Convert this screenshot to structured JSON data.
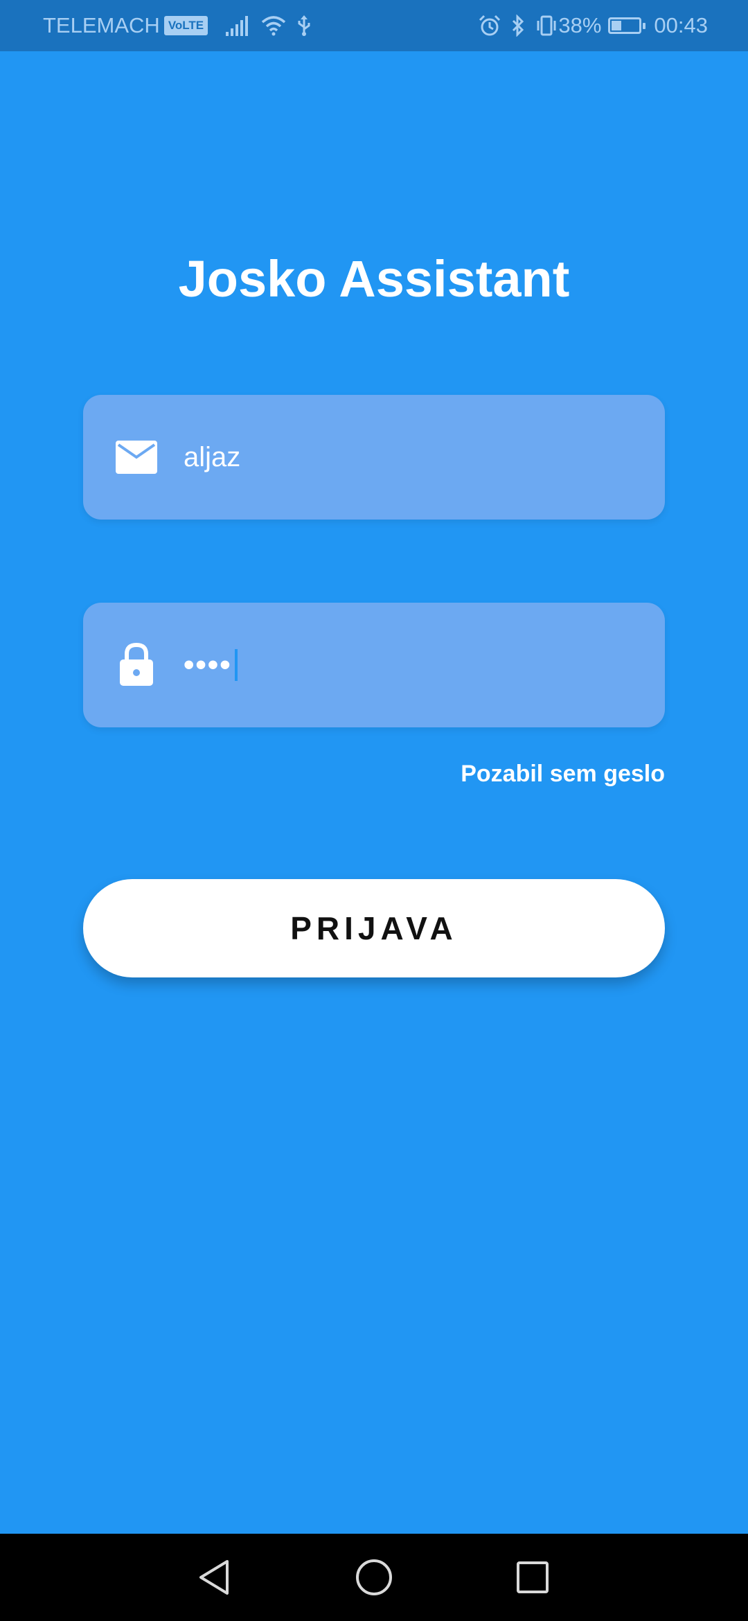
{
  "status_bar": {
    "carrier": "TELEMACH",
    "volte": "VoLTE",
    "battery_percent": "38%",
    "battery_level": 0.38,
    "time": "00:43",
    "icons": [
      "signal-icon",
      "wifi-icon",
      "usb-icon",
      "alarm-icon",
      "bluetooth-icon",
      "vibrate-icon",
      "battery-charging-icon"
    ]
  },
  "app": {
    "title": "Josko Assistant"
  },
  "login_form": {
    "email": {
      "icon": "mail-icon",
      "value": "aljaz"
    },
    "password": {
      "icon": "lock-icon",
      "value": "••••"
    },
    "forgot_password_label": "Pozabil sem geslo",
    "submit_label": "PRIJAVA"
  },
  "nav_bar": {
    "icons": [
      "back-icon",
      "home-icon",
      "recent-apps-icon"
    ]
  },
  "colors": {
    "background": "#2196F3",
    "status_bar": "#1A72BE",
    "field_background": "#6CA9F2",
    "button_background": "#FFFFFF",
    "button_text": "#111111"
  }
}
